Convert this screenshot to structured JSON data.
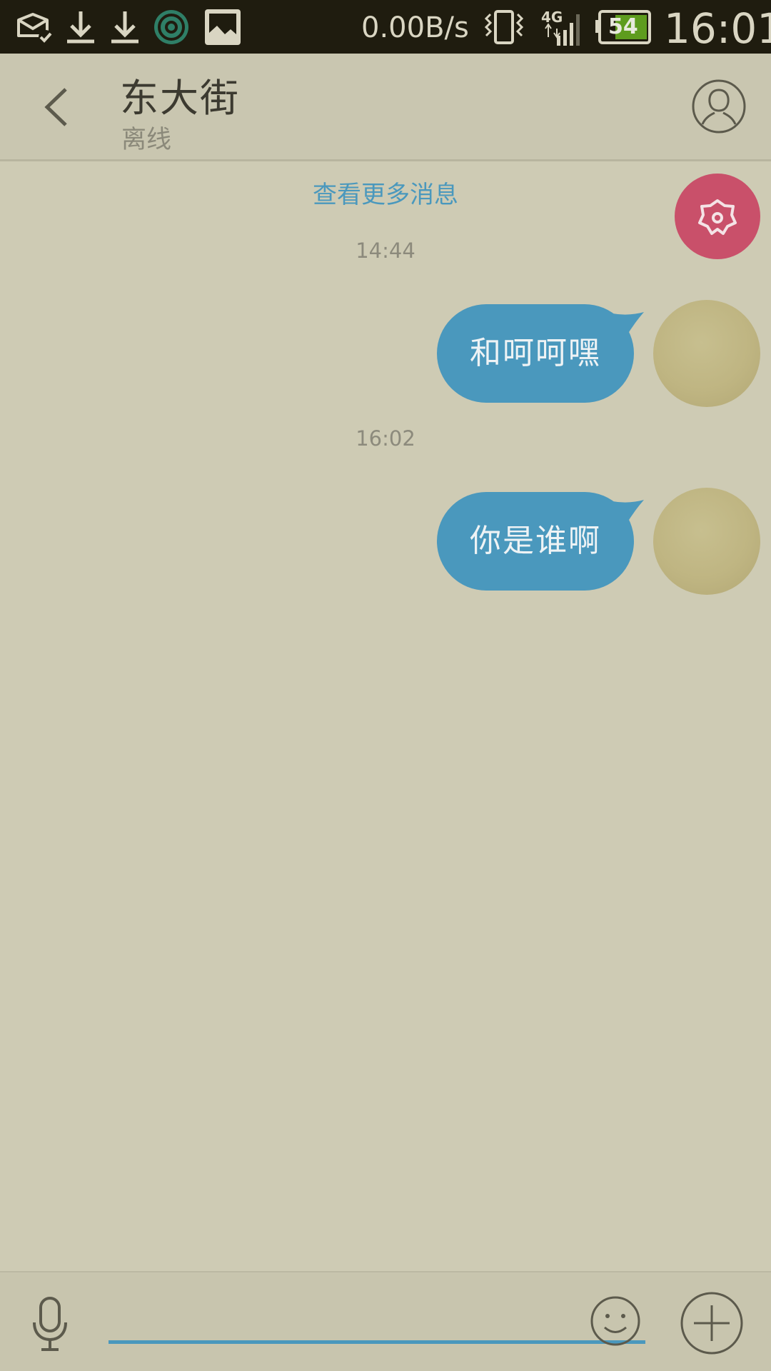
{
  "status_bar": {
    "net_speed": "0.00B/s",
    "network_type": "4G",
    "battery_level": "54",
    "time": "16:01",
    "icons": [
      "mail-check-icon",
      "download-icon",
      "download-icon",
      "eye-app-icon",
      "image-icon",
      "vibrate-icon",
      "signal-icon",
      "battery-icon"
    ]
  },
  "header": {
    "contact_name": "东大街",
    "contact_status": "离线",
    "back_icon": "back-arrow-icon",
    "profile_icon": "person-icon"
  },
  "chat": {
    "load_more": "查看更多消息",
    "fab_icon": "flower-icon",
    "messages": [
      {
        "time": "14:44",
        "text": "和呵呵嘿",
        "from": "self"
      },
      {
        "time": "16:02",
        "text": "你是谁啊",
        "from": "self"
      }
    ]
  },
  "input_bar": {
    "value": "",
    "placeholder": "",
    "mic_icon": "microphone-icon",
    "emoji_icon": "smiley-icon",
    "plus_icon": "plus-icon"
  },
  "colors": {
    "accent": "#4a98bd",
    "background": "#cecbb4",
    "fab": "#c9506a",
    "status_bar": "#1f1c0f"
  }
}
